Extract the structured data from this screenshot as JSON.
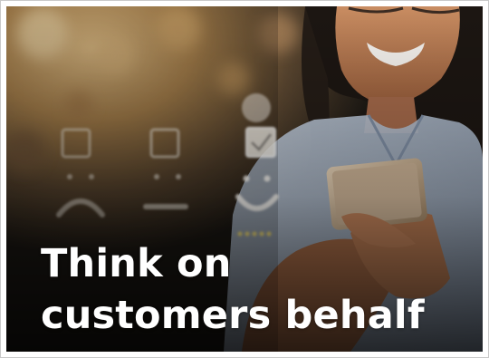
{
  "headline": {
    "line1": "Think on",
    "line2": "customers behalf"
  },
  "scene": {
    "description_icons": [
      "sad-face-icon",
      "neutral-face-icon",
      "happy-face-icon"
    ],
    "colors": {
      "warm_highlight": "#d9a860",
      "shadow": "#1a1612",
      "sleeve": "#b9c6d8",
      "rating_stars": "#e8d36a"
    }
  }
}
